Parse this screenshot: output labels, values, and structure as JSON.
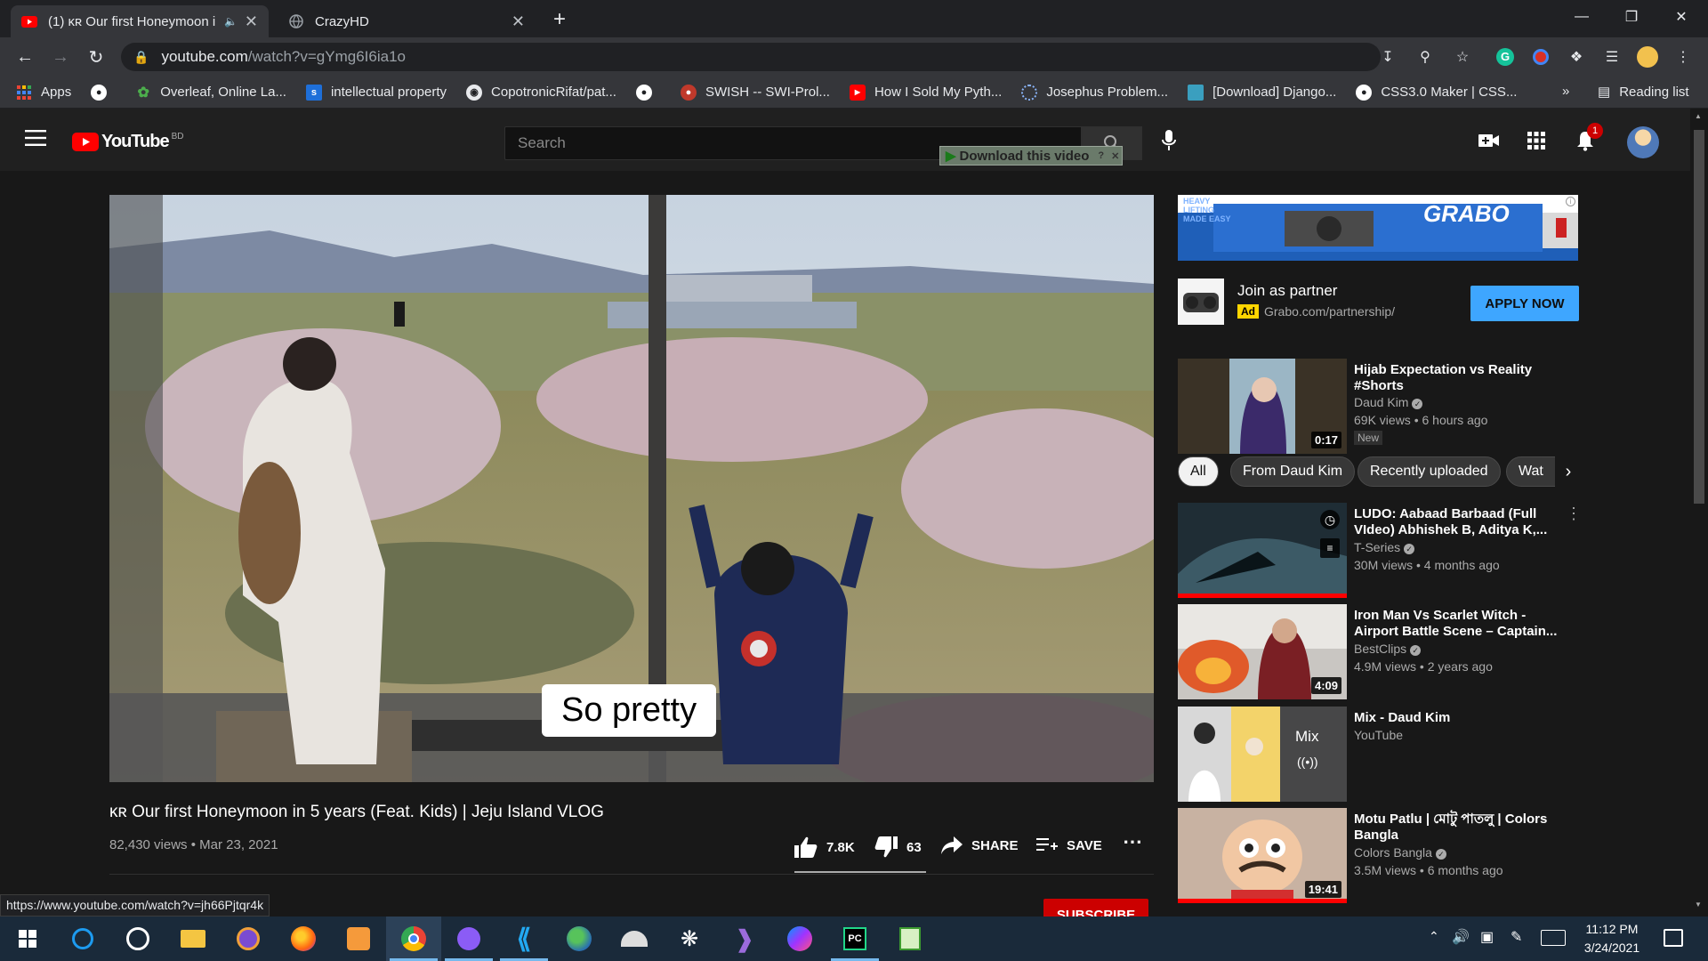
{
  "browser": {
    "tabs": [
      {
        "title": "(1) κʀ Our first Honeymoon i",
        "active": true
      },
      {
        "title": "CrazyHD",
        "active": false
      }
    ],
    "url_host": "youtube.com",
    "url_path": "/watch?v=gYmg6I6ia1o",
    "bookmarks": [
      "Apps",
      "Overleaf, Online La...",
      "intellectual property",
      "CopotronicRifat/pat...",
      "SWISH -- SWI-Prol...",
      "How I Sold My Pyth...",
      "Josephus Problem...",
      "[Download] Django...",
      "CSS3.0 Maker | CSS..."
    ],
    "bookmarks_more": "»",
    "reading_list": "Reading list",
    "status_url": "https://www.youtube.com/watch?v=jh66Pjtqr4k"
  },
  "youtube": {
    "logo_text": "YouTube",
    "country": "BD",
    "search_placeholder": "Search",
    "download_bar": "Download this video",
    "notifications_count": "1",
    "caption": "So pretty",
    "video_title": "κʀ Our first Honeymoon in 5 years (Feat. Kids) | Jeju Island VLOG",
    "views": "82,430 views",
    "date": "Mar 23, 2021",
    "likes": "7.8K",
    "dislikes": "63",
    "share": "SHARE",
    "save": "SAVE",
    "subscribe": "SUBSCRIBE",
    "ad": {
      "title": "Join as partner",
      "badge": "Ad",
      "domain": "Grabo.com/partnership/",
      "cta": "APPLY NOW",
      "banner_brand": "GRABO",
      "banner_tag": "HEAVY LIFTING MADE EASY"
    },
    "chips": [
      "All",
      "From Daud Kim",
      "Recently uploaded",
      "Wat"
    ],
    "suggestions": [
      {
        "title": "Hijab Expectation vs Reality #Shorts",
        "channel": "Daud Kim",
        "verified": true,
        "meta": "69K views • 6 hours ago",
        "badge": "New",
        "duration": "0:17"
      },
      {
        "title": "LUDO: Aabaad Barbaad (Full VIdeo) Abhishek B, Aditya K,...",
        "channel": "T-Series",
        "verified": true,
        "meta": "30M views • 4 months ago",
        "duration": ""
      },
      {
        "title": "Iron Man Vs Scarlet Witch - Airport Battle Scene – Captain...",
        "channel": "BestClips",
        "verified": true,
        "meta": "4.9M views • 2 years ago",
        "duration": "4:09"
      },
      {
        "title": "Mix - Daud Kim",
        "channel": "YouTube",
        "verified": false,
        "meta": "",
        "duration": "",
        "mix_label": "Mix"
      },
      {
        "title": "Motu Patlu | মোটু পাতলু | Colors Bangla",
        "channel": "Colors Bangla",
        "verified": true,
        "meta": "3.5M views • 6 months ago",
        "duration": "19:41"
      }
    ]
  },
  "taskbar": {
    "time": "11:12 PM",
    "date": "3/24/2021"
  },
  "colors": {
    "yt_red": "#ff0000",
    "apply_blue": "#3ea6ff",
    "ad_yellow": "#ffd600",
    "like_bar": "#aaaaaa"
  }
}
